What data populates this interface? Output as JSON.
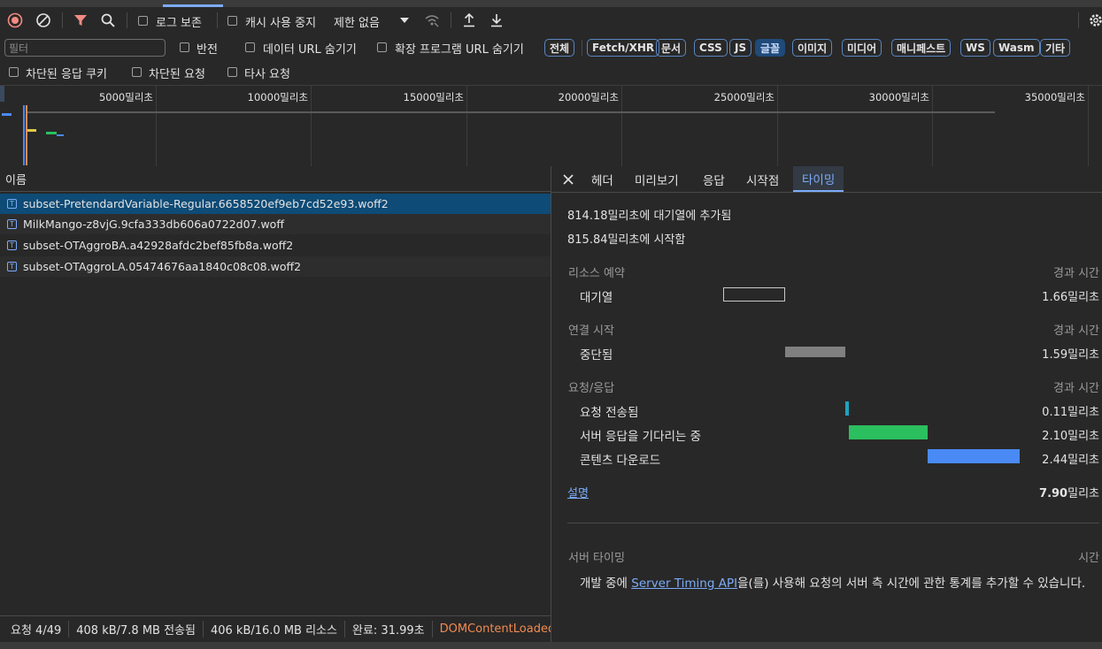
{
  "toolbar": {
    "preserve_log": "로그 보존",
    "disable_cache": "캐시 사용 중지",
    "throttle": "제한 없음"
  },
  "filterbar": {
    "placeholder": "필터",
    "invert": "반전",
    "hide_data_urls": "데이터 URL 숨기기",
    "hide_ext_urls": "확장 프로그램 URL 숨기기",
    "chips": [
      "전체",
      "Fetch/XHR",
      "문서",
      "CSS",
      "JS",
      "글꼴",
      "이미지",
      "미디어",
      "매니페스트",
      "WS",
      "Wasm",
      "기타"
    ],
    "selected_chip": "글꼴",
    "blocked_cookies": "차단된 응답 쿠키",
    "blocked_requests": "차단된 요청",
    "third_party": "타사 요청"
  },
  "overview": {
    "ticks": [
      "5000밀리초",
      "10000밀리초",
      "15000밀리초",
      "20000밀리초",
      "25000밀리초",
      "30000밀리초",
      "35000밀리초"
    ]
  },
  "requests": {
    "header": "이름",
    "items": [
      "subset-PretendardVariable-Regular.6658520ef9eb7cd52e93.woff2",
      "MilkMango-z8vjG.9cfa333db606a0722d07.woff",
      "subset-OTAggroBA.a42928afdc2bef85fb8a.woff2",
      "subset-OTAggroLA.05474676aa1840c08c08.woff2"
    ],
    "selected_index": 0
  },
  "statusbar": {
    "requests": "요청 4/49",
    "transferred": "408 kB/7.8 MB 전송됨",
    "resources": "406 kB/16.0 MB 리소스",
    "finish": "완료: 31.99초",
    "dom_content_loaded": "DOMContentLoaded"
  },
  "details": {
    "tabs": [
      "헤더",
      "미리보기",
      "응답",
      "시작점",
      "타이밍"
    ],
    "active_tab": "타이밍",
    "queued_at": "814.18밀리초에 대기열에 추가됨",
    "started_at": "815.84밀리초에 시작함",
    "col_duration": "경과 시간",
    "sections": [
      {
        "title": "리소스 예약",
        "phases": [
          {
            "label": "대기열",
            "value": "1.66밀리초"
          }
        ]
      },
      {
        "title": "연결 시작",
        "phases": [
          {
            "label": "중단됨",
            "value": "1.59밀리초"
          }
        ]
      },
      {
        "title": "요청/응답",
        "phases": [
          {
            "label": "요청 전송됨",
            "value": "0.11밀리초"
          },
          {
            "label": "서버 응답을 기다리는 중",
            "value": "2.10밀리초"
          },
          {
            "label": "콘텐츠 다운로드",
            "value": "2.44밀리초"
          }
        ]
      }
    ],
    "explanation": "설명",
    "total": "7.90",
    "total_unit": "밀리초",
    "server_timing": "서버 타이밍",
    "server_col": "시간",
    "server_note_prefix": "개발 중에 ",
    "server_note_link": "Server Timing API",
    "server_note_suffix": "을(를) 사용해 요청의 서버 측 시간에 관한 통계를 추가할 수 있습니다."
  },
  "colors": {
    "accent": "#7cacf8",
    "record": "#f28b82",
    "filter": "#f28b82",
    "stalled": "#808080",
    "request_sent": "#1fa2c0",
    "waiting": "#2bbf5f",
    "download": "#4a8af4",
    "dcl": "#f28b50"
  }
}
